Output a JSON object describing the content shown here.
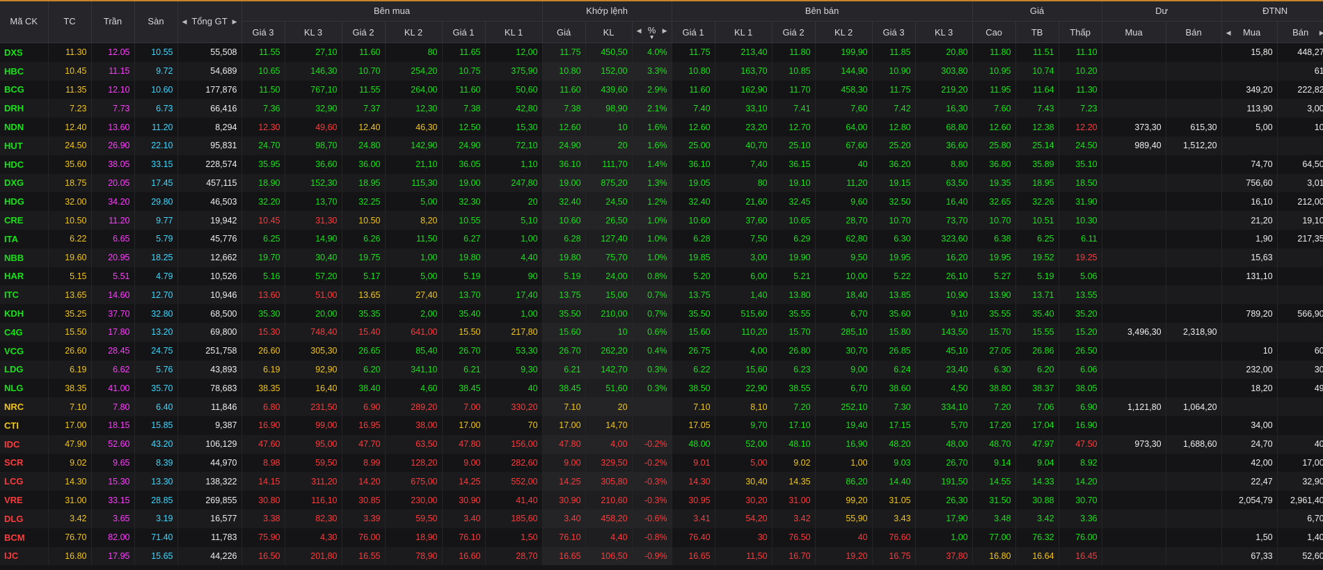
{
  "header": {
    "symbol": "Mã CK",
    "ref": "TC",
    "ceil": "Trần",
    "floor": "Sàn",
    "total": "Tổng GT",
    "bid_group": "Bên mua",
    "match_group": "Khớp lệnh",
    "ask_group": "Bên bán",
    "price_group": "Giá",
    "oi_group": "Dư",
    "foreign_group": "ĐTNN",
    "bid_cols": [
      "Giá 3",
      "KL 3",
      "Giá 2",
      "KL 2",
      "Giá 1",
      "KL 1"
    ],
    "match_cols": [
      "Giá",
      "KL",
      "%"
    ],
    "ask_cols": [
      "Giá 1",
      "KL 1",
      "Giá 2",
      "KL 2",
      "Giá 3",
      "KL 3"
    ],
    "price_cols": [
      "Cao",
      "TB",
      "Thấp"
    ],
    "oi_cols": [
      "Mua",
      "Bán"
    ],
    "foreign_cols": [
      "Mua",
      "Bán"
    ]
  },
  "colors": {
    "up": "#19e219",
    "down": "#ff3a3a",
    "ref": "#f2c519",
    "ceil": "#ff3cff",
    "floor": "#3cd8ff",
    "neutral": "#ededed",
    "accent": "#c8842a"
  },
  "rows": [
    {
      "c": [
        "DXS",
        "11.30",
        "12.05",
        "10.55",
        "55,508",
        "11.55",
        "27,10",
        "11.60",
        "80",
        "11.65",
        "12,00",
        "11.75",
        "450,50",
        "4.0%",
        "11.75",
        "213,40",
        "11.80",
        "199,90",
        "11.85",
        "20,80",
        "11.80",
        "11.51",
        "11.10",
        "",
        "",
        "15,80",
        "448,27"
      ],
      "k": "uryfwuuuuuuuuuuuuuuuuuudwwww"
    },
    {
      "c": [
        "HBC",
        "10.45",
        "11.15",
        "9.72",
        "54,689",
        "10.65",
        "146,30",
        "10.70",
        "254,20",
        "10.75",
        "375,90",
        "10.80",
        "152,00",
        "3.3%",
        "10.80",
        "163,70",
        "10.85",
        "144,90",
        "10.90",
        "303,80",
        "10.95",
        "10.74",
        "10.20",
        "",
        "",
        "",
        "61"
      ],
      "k": "uryfwuuuuuuuuuuuuuuuuuudwwww"
    },
    {
      "c": [
        "BCG",
        "11.35",
        "12.10",
        "10.60",
        "177,876",
        "11.50",
        "767,10",
        "11.55",
        "264,00",
        "11.60",
        "50,60",
        "11.60",
        "439,60",
        "2.9%",
        "11.60",
        "162,90",
        "11.70",
        "458,30",
        "11.75",
        "219,20",
        "11.95",
        "11.64",
        "11.30",
        "",
        "",
        "349,20",
        "222,82"
      ],
      "k": "uryfwuuuuuuuuuuuuuuuuuudwwww"
    },
    {
      "c": [
        "DRH",
        "7.23",
        "7.73",
        "6.73",
        "66,416",
        "7.36",
        "32,90",
        "7.37",
        "12,30",
        "7.38",
        "42,80",
        "7.38",
        "98,90",
        "2.1%",
        "7.40",
        "33,10",
        "7.41",
        "7,60",
        "7.42",
        "16,30",
        "7.60",
        "7.43",
        "7.23",
        "",
        "",
        "113,90",
        "3,00"
      ],
      "k": "uryfwuuuuuuuuuuuuuuuuuurwwww"
    },
    {
      "c": [
        "NDN",
        "12.40",
        "13.60",
        "11.20",
        "8,294",
        "12.30",
        "49,60",
        "12.40",
        "46,30",
        "12.50",
        "15,30",
        "12.60",
        "10",
        "1.6%",
        "12.60",
        "23,20",
        "12.70",
        "64,00",
        "12.80",
        "68,80",
        "12.60",
        "12.38",
        "12.20",
        "373,30",
        "615,30",
        "5,00",
        "10"
      ],
      "k": "uryfwddrruuuuuuuuuuuuudddwwww"
    },
    {
      "c": [
        "HUT",
        "24.50",
        "26.90",
        "22.10",
        "95,831",
        "24.70",
        "98,70",
        "24.80",
        "142,90",
        "24.90",
        "72,10",
        "24.90",
        "20",
        "1.6%",
        "25.00",
        "40,70",
        "25.10",
        "67,60",
        "25.20",
        "36,60",
        "25.80",
        "25.14",
        "24.50",
        "989,40",
        "1,512,20",
        "",
        ""
      ],
      "k": "uryfwuuuuuuuuuuuuuuuuuurwwww"
    },
    {
      "c": [
        "HDC",
        "35.60",
        "38.05",
        "33.15",
        "228,574",
        "35.95",
        "36,60",
        "36.00",
        "21,10",
        "36.05",
        "1,10",
        "36.10",
        "111,70",
        "1.4%",
        "36.10",
        "7,40",
        "36.15",
        "40",
        "36.20",
        "8,80",
        "36.80",
        "35.89",
        "35.10",
        "",
        "",
        "74,70",
        "64,50"
      ],
      "k": "uryfwuuuuuuuuuuuuuuuuuudwwww"
    },
    {
      "c": [
        "DXG",
        "18.75",
        "20.05",
        "17.45",
        "457,115",
        "18.90",
        "152,30",
        "18.95",
        "115,30",
        "19.00",
        "247,80",
        "19.00",
        "875,20",
        "1.3%",
        "19.05",
        "80",
        "19.10",
        "11,20",
        "19.15",
        "63,50",
        "19.35",
        "18.95",
        "18.50",
        "",
        "",
        "756,60",
        "3,01"
      ],
      "k": "uryfwuuuuuuuuuuuuuuuuuudwwww"
    },
    {
      "c": [
        "HDG",
        "32.00",
        "34.20",
        "29.80",
        "46,503",
        "32.20",
        "13,70",
        "32.25",
        "5,00",
        "32.30",
        "20",
        "32.40",
        "24,50",
        "1.2%",
        "32.40",
        "21,60",
        "32.45",
        "9,60",
        "32.50",
        "16,40",
        "32.65",
        "32.26",
        "31.90",
        "",
        "",
        "16,10",
        "212,00"
      ],
      "k": "uryfwuuuuuuuuuuuuuuuuuudwwww"
    },
    {
      "c": [
        "CRE",
        "10.50",
        "11.20",
        "9.77",
        "19,942",
        "10.45",
        "31,30",
        "10.50",
        "8,20",
        "10.55",
        "5,10",
        "10.60",
        "26,50",
        "1.0%",
        "10.60",
        "37,60",
        "10.65",
        "28,70",
        "10.70",
        "73,70",
        "10.70",
        "10.51",
        "10.30",
        "",
        "",
        "21,20",
        "19,10"
      ],
      "k": "uryfwddrruuuuuuuuuuuuuudwwww"
    },
    {
      "c": [
        "ITA",
        "6.22",
        "6.65",
        "5.79",
        "45,776",
        "6.25",
        "14,90",
        "6.26",
        "11,50",
        "6.27",
        "1,00",
        "6.28",
        "127,40",
        "1.0%",
        "6.28",
        "7,50",
        "6.29",
        "62,80",
        "6.30",
        "323,60",
        "6.38",
        "6.25",
        "6.11",
        "",
        "",
        "1,90",
        "217,35"
      ],
      "k": "uryfwuuuuuuuuuuuuuuuuuudwwww"
    },
    {
      "c": [
        "NBB",
        "19.60",
        "20.95",
        "18.25",
        "12,662",
        "19.70",
        "30,40",
        "19.75",
        "1,00",
        "19.80",
        "4,40",
        "19.80",
        "75,70",
        "1.0%",
        "19.85",
        "3,00",
        "19.90",
        "9,50",
        "19.95",
        "16,20",
        "19.95",
        "19.52",
        "19.25",
        "",
        "",
        "15,63",
        ""
      ],
      "k": "uryfwuuuuuuuuuuuuuuuuuddwwww"
    },
    {
      "c": [
        "HAR",
        "5.15",
        "5.51",
        "4.79",
        "10,526",
        "5.16",
        "57,20",
        "5.17",
        "5,00",
        "5.19",
        "90",
        "5.19",
        "24,00",
        "0.8%",
        "5.20",
        "6,00",
        "5.21",
        "10,00",
        "5.22",
        "26,10",
        "5.27",
        "5.19",
        "5.06",
        "",
        "",
        "131,10",
        ""
      ],
      "k": "uryfwuuuuuuuuuuuuuuuuuudwwww"
    },
    {
      "c": [
        "ITC",
        "13.65",
        "14.60",
        "12.70",
        "10,946",
        "13.60",
        "51,00",
        "13.65",
        "27,40",
        "13.70",
        "17,40",
        "13.75",
        "15,00",
        "0.7%",
        "13.75",
        "1,40",
        "13.80",
        "18,40",
        "13.85",
        "10,90",
        "13.90",
        "13.71",
        "13.55",
        "",
        "",
        "",
        ""
      ],
      "k": "uryfwddrruuuuuuuuuuuuuudwwww"
    },
    {
      "c": [
        "KDH",
        "35.25",
        "37.70",
        "32.80",
        "68,500",
        "35.30",
        "20,00",
        "35.35",
        "2,00",
        "35.40",
        "1,00",
        "35.50",
        "210,00",
        "0.7%",
        "35.50",
        "515,60",
        "35.55",
        "6,70",
        "35.60",
        "9,10",
        "35.55",
        "35.40",
        "35.20",
        "",
        "",
        "789,20",
        "566,90"
      ],
      "k": "uryfwuuuuuuuuuuuuuuuuuudwwww"
    },
    {
      "c": [
        "C4G",
        "15.50",
        "17.80",
        "13.20",
        "69,800",
        "15.30",
        "748,40",
        "15.40",
        "641,00",
        "15.50",
        "217,80",
        "15.60",
        "10",
        "0.6%",
        "15.60",
        "110,20",
        "15.70",
        "285,10",
        "15.80",
        "143,50",
        "15.70",
        "15.55",
        "15.20",
        "3,496,30",
        "2,318,90",
        "",
        ""
      ],
      "k": "uryfwddddrruuuuuuuuuuuudwwww"
    },
    {
      "c": [
        "VCG",
        "26.60",
        "28.45",
        "24.75",
        "251,758",
        "26.60",
        "305,30",
        "26.65",
        "85,40",
        "26.70",
        "53,30",
        "26.70",
        "262,20",
        "0.4%",
        "26.75",
        "4,00",
        "26.80",
        "30,70",
        "26.85",
        "45,10",
        "27.05",
        "26.86",
        "26.50",
        "",
        "",
        "10",
        "60"
      ],
      "k": "uryfwrruuuuuuuuuuuuuuuudwwww"
    },
    {
      "c": [
        "LDG",
        "6.19",
        "6.62",
        "5.76",
        "43,893",
        "6.19",
        "92,90",
        "6.20",
        "341,10",
        "6.21",
        "9,30",
        "6.21",
        "142,70",
        "0.3%",
        "6.22",
        "15,60",
        "6.23",
        "9,00",
        "6.24",
        "23,40",
        "6.30",
        "6.20",
        "6.06",
        "",
        "",
        "232,00",
        "30"
      ],
      "k": "uryfwrruuuuuuuuuuuuuuuudwwww"
    },
    {
      "c": [
        "NLG",
        "38.35",
        "41.00",
        "35.70",
        "78,683",
        "38.35",
        "16,40",
        "38.40",
        "4,60",
        "38.45",
        "40",
        "38.45",
        "51,60",
        "0.3%",
        "38.50",
        "22,90",
        "38.55",
        "6,70",
        "38.60",
        "4,50",
        "38.80",
        "38.37",
        "38.05",
        "",
        "",
        "18,20",
        "49"
      ],
      "k": "uryfwrruuuuuuuuuuuuuuuudwwww"
    },
    {
      "c": [
        "NRC",
        "7.10",
        "7.80",
        "6.40",
        "11,846",
        "6.80",
        "231,50",
        "6.90",
        "289,20",
        "7.00",
        "330,20",
        "7.10",
        "20",
        "",
        "7.10",
        "8,10",
        "7.20",
        "252,10",
        "7.30",
        "334,10",
        "7.20",
        "7.06",
        "6.90",
        "1,121,80",
        "1,064,20",
        "",
        ""
      ],
      "k": "rryfwddddddrrrrruuuuuuudwwwwr"
    },
    {
      "c": [
        "CTI",
        "17.00",
        "18.15",
        "15.85",
        "9,387",
        "16.90",
        "99,00",
        "16.95",
        "38,00",
        "17.00",
        "70",
        "17.00",
        "14,70",
        "",
        "17.05",
        "9,70",
        "17.10",
        "19,40",
        "17.15",
        "5,70",
        "17.20",
        "17.04",
        "16.90",
        "",
        "",
        "34,00",
        ""
      ],
      "k": "rryfwddddrrrrrruuuuuuuudwwww"
    },
    {
      "c": [
        "IDC",
        "47.90",
        "52.60",
        "43.20",
        "106,129",
        "47.60",
        "95,00",
        "47.70",
        "63,50",
        "47.80",
        "156,00",
        "47.80",
        "4,00",
        "-0.2%",
        "48.00",
        "52,00",
        "48.10",
        "16,90",
        "48.20",
        "48,00",
        "48.70",
        "47.97",
        "47.50",
        "973,30",
        "1,688,60",
        "24,70",
        "40"
      ],
      "k": "dryfwddddddddduuuuuuuudwwww"
    },
    {
      "c": [
        "SCR",
        "9.02",
        "9.65",
        "8.39",
        "44,970",
        "8.98",
        "59,50",
        "8.99",
        "128,20",
        "9.00",
        "282,60",
        "9.00",
        "329,50",
        "-0.2%",
        "9.01",
        "5,00",
        "9.02",
        "1,00",
        "9.03",
        "26,70",
        "9.14",
        "9.04",
        "8.92",
        "",
        "",
        "42,00",
        "17,00"
      ],
      "k": "dryfwdddddddddddrruuuuudwwww"
    },
    {
      "c": [
        "LCG",
        "14.30",
        "15.30",
        "13.30",
        "138,322",
        "14.15",
        "311,20",
        "14.20",
        "675,00",
        "14.25",
        "552,00",
        "14.25",
        "305,80",
        "-0.3%",
        "14.30",
        "30,40",
        "14.35",
        "86,20",
        "14.40",
        "191,50",
        "14.55",
        "14.33",
        "14.20",
        "",
        "",
        "22,47",
        "32,90"
      ],
      "k": "dryfwddddddddddrruuuuuudwwww"
    },
    {
      "c": [
        "VRE",
        "31.00",
        "33.15",
        "28.85",
        "269,855",
        "30.80",
        "116,10",
        "30.85",
        "230,00",
        "30.90",
        "41,40",
        "30.90",
        "210,60",
        "-0.3%",
        "30.95",
        "30,20",
        "31.00",
        "99,20",
        "31.05",
        "26,30",
        "31.50",
        "30.88",
        "30.70",
        "",
        "",
        "2,054,79",
        "2,961,40"
      ],
      "k": "dryfwddddddddddddrruuuudwwww"
    },
    {
      "c": [
        "DLG",
        "3.42",
        "3.65",
        "3.19",
        "16,577",
        "3.38",
        "82,30",
        "3.39",
        "59,50",
        "3.40",
        "185,60",
        "3.40",
        "458,20",
        "-0.6%",
        "3.41",
        "54,20",
        "3.42",
        "55,90",
        "3.43",
        "17,90",
        "3.48",
        "3.42",
        "3.36",
        "",
        "",
        "",
        "6,70"
      ],
      "k": "dryfwddddddddddddrruuuudwwww"
    },
    {
      "c": [
        "BCM",
        "76.70",
        "82.00",
        "71.40",
        "11,783",
        "75.90",
        "4,30",
        "76.00",
        "18,90",
        "76.10",
        "1,50",
        "76.10",
        "4,40",
        "-0.8%",
        "76.40",
        "30",
        "76.50",
        "40",
        "76.60",
        "1,00",
        "77.00",
        "76.32",
        "76.00",
        "",
        "",
        "1,50",
        "1,40"
      ],
      "k": "dryfwdddddddddddddduuuudwwww"
    },
    {
      "c": [
        "IJC",
        "16.80",
        "17.95",
        "15.65",
        "44,226",
        "16.50",
        "201,80",
        "16.55",
        "78,90",
        "16.60",
        "28,70",
        "16.65",
        "106,50",
        "-0.9%",
        "16.65",
        "11,50",
        "16.70",
        "19,20",
        "16.75",
        "37,80",
        "16.80",
        "16.64",
        "16.45",
        "",
        "",
        "67,33",
        "52,60"
      ],
      "k": "dryfwdddddddddddddddrrddwwww"
    }
  ]
}
